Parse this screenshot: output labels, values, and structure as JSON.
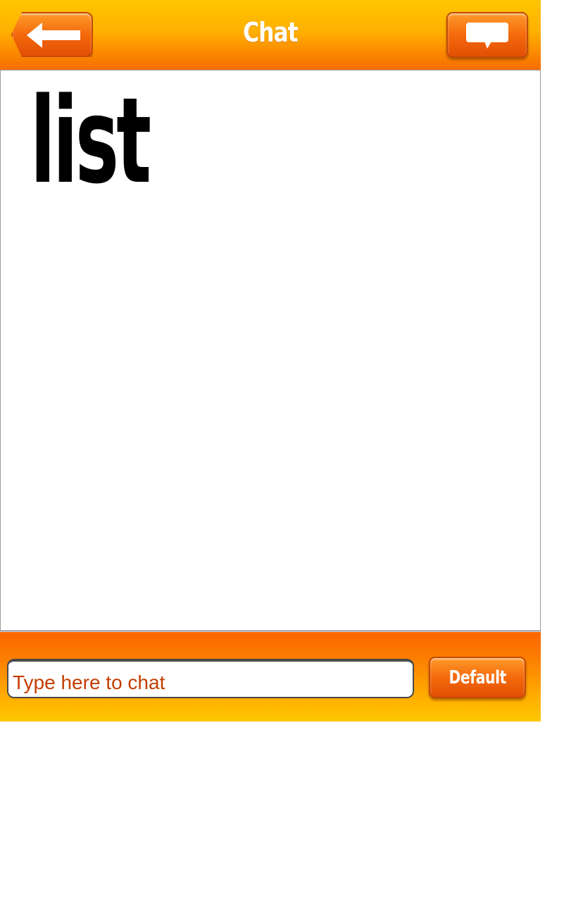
{
  "header": {
    "title": "Chat",
    "back_icon": "arrow-left-icon",
    "chat_icon": "speech-bubble-icon"
  },
  "messages": [
    {
      "text": "list"
    }
  ],
  "footer": {
    "input_value": "",
    "input_placeholder": "Type here to chat",
    "default_label": "Default"
  },
  "colors": {
    "accent_orange": "#f46a0c",
    "header_top_yellow": "#ffc600",
    "placeholder_text": "#c33e00"
  }
}
